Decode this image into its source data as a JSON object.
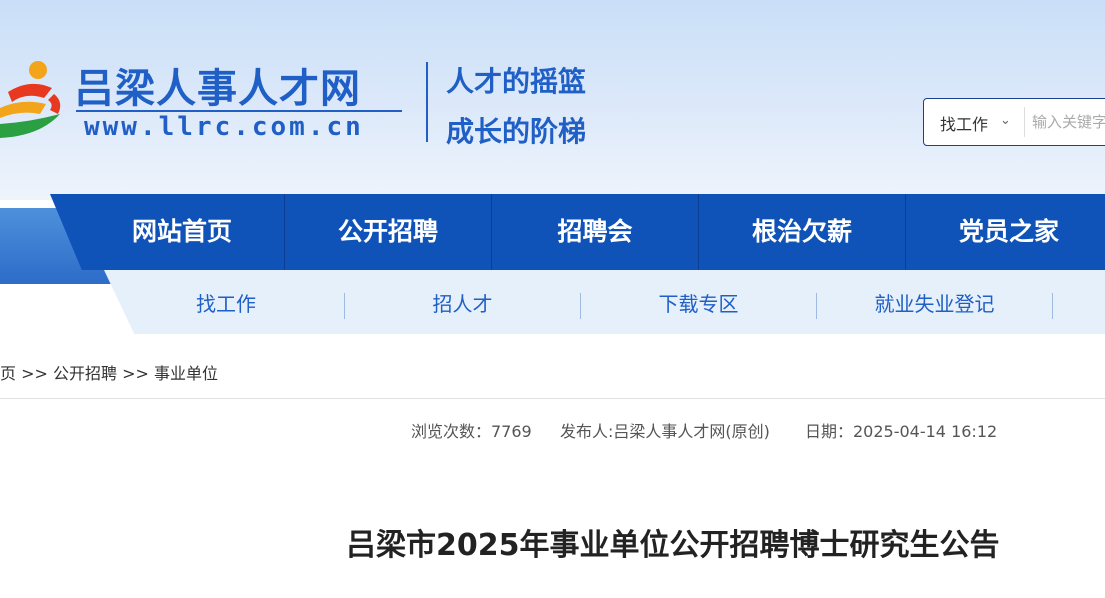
{
  "header": {
    "site_name": "吕梁人事人才网",
    "site_url": "www.llrc.com.cn",
    "slogan_line1": "人才的摇篮",
    "slogan_line2": "成长的阶梯",
    "brand_color": "#1f5fc6",
    "logo_icon": "runner-logo-icon"
  },
  "search": {
    "category_label": "找工作",
    "placeholder": "输入关键字"
  },
  "main_nav": [
    "网站首页",
    "公开招聘",
    "招聘会",
    "根治欠薪",
    "党员之家"
  ],
  "sub_nav": [
    "找工作",
    "招人才",
    "下载专区",
    "就业失业登记"
  ],
  "breadcrumb": {
    "home": "首页",
    "sep": " >> ",
    "section": "公开招聘",
    "current": "事业单位"
  },
  "article": {
    "views": "浏览次数：7769",
    "publisher": "发布人:吕梁人事人才网(原创)",
    "date": "日期：2025-04-14 16:12",
    "title": "吕梁市2025年事业单位公开招聘博士研究生公告"
  },
  "colors": {
    "nav_bg": "#0f52b8",
    "subnav_bg": "#e6f0fb",
    "header_bg": "#c9dff7"
  }
}
